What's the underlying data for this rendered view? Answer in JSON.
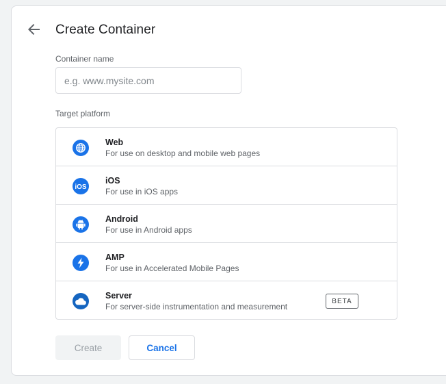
{
  "header": {
    "title": "Create Container"
  },
  "container_name": {
    "label": "Container name",
    "value": "",
    "placeholder": "e.g. www.mysite.com"
  },
  "target_platform": {
    "label": "Target platform",
    "items": [
      {
        "name": "Web",
        "description": "For use on desktop and mobile web pages",
        "icon": "globe-icon"
      },
      {
        "name": "iOS",
        "description": "For use in iOS apps",
        "icon": "ios-icon",
        "icon_text": "iOS"
      },
      {
        "name": "Android",
        "description": "For use in Android apps",
        "icon": "android-icon"
      },
      {
        "name": "AMP",
        "description": "For use in Accelerated Mobile Pages",
        "icon": "lightning-icon"
      },
      {
        "name": "Server",
        "description": "For server-side instrumentation and measurement",
        "icon": "cloud-icon",
        "badge": "BETA"
      }
    ]
  },
  "actions": {
    "create_label": "Create",
    "cancel_label": "Cancel"
  },
  "colors": {
    "accent": "#1a73e8",
    "border": "#dadce0",
    "muted_text": "#5f6368",
    "disabled_bg": "#f1f3f4"
  }
}
